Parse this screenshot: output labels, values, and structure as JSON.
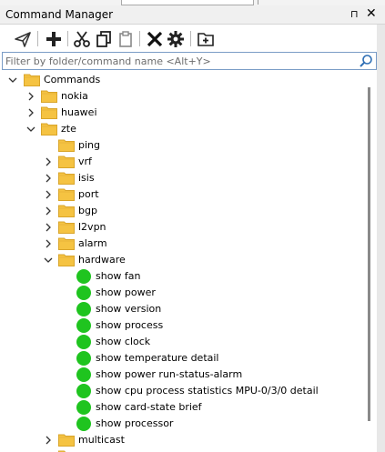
{
  "window": {
    "title": "Command Manager",
    "pin_icon": "⊓",
    "close_icon": "✕"
  },
  "toolbar": {
    "icons": [
      "send-icon",
      "add-icon",
      "cut-icon",
      "copy-icon",
      "paste-icon",
      "delete-icon",
      "settings-icon",
      "add-folder-icon"
    ]
  },
  "filter": {
    "placeholder": "Filter by folder/command name <Alt+Y>",
    "value": ""
  },
  "tree": {
    "root": "Commands",
    "vendors": {
      "nokia": "nokia",
      "huawei": "huawei",
      "zte": "zte"
    },
    "zte_children": {
      "ping": "ping",
      "vrf": "vrf",
      "isis": "isis",
      "port": "port",
      "bgp": "bgp",
      "l2vpn": "l2vpn",
      "alarm": "alarm",
      "hardware": "hardware",
      "multicast": "multicast"
    },
    "hardware_commands": [
      "show fan",
      "show power",
      "show version",
      "show process",
      "show clock",
      "show temperature detail",
      "show power run-status-alarm",
      "show cpu process statistics MPU-0/3/0 detail",
      "show card-state brief",
      "show processor"
    ]
  },
  "colors": {
    "folder": "#f5c342",
    "command_status": "#1fc41f",
    "filter_border": "#7a9cc6"
  }
}
